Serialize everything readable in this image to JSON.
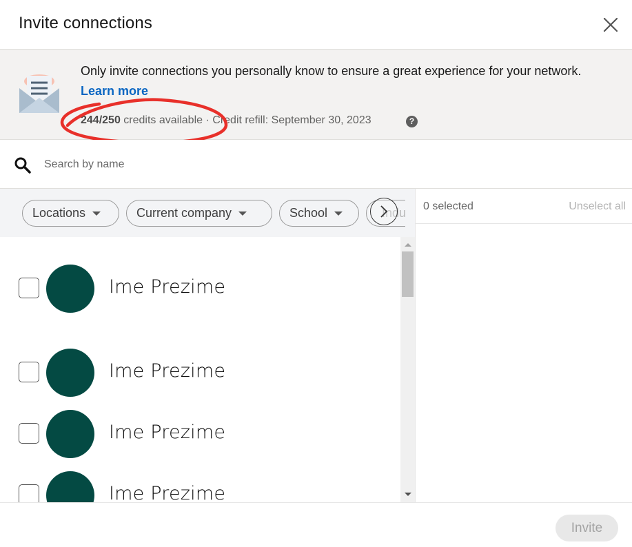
{
  "header": {
    "title": "Invite connections",
    "close_icon": "close-icon"
  },
  "notice": {
    "icon": "envelope-icon",
    "message": "Only invite connections you personally know to ensure a great experience for your network.",
    "learn_more": "Learn more",
    "credits_used": "244/250",
    "credits_label": "credits available",
    "separator": "·",
    "refill_label": "Credit refill: September 30, 2023",
    "help_icon": "help-icon",
    "help_glyph": "?"
  },
  "annotation": {
    "color": "#e8302a",
    "shape": "hand-drawn-ellipse"
  },
  "search": {
    "icon": "search-icon",
    "placeholder": "Search by name",
    "value": ""
  },
  "filters": [
    {
      "label": "Locations"
    },
    {
      "label": "Current company"
    },
    {
      "label": "School"
    },
    {
      "label": "Indu"
    }
  ],
  "filters_next_icon": "chevron-right-icon",
  "selection": {
    "count_label": "0 selected",
    "unselect_all": "Unselect all"
  },
  "connections": [
    {
      "name": "Ime Prezime",
      "checked": false,
      "avatar_color": "#044a43"
    },
    {
      "name": "Ime Prezime",
      "checked": false,
      "avatar_color": "#044a43"
    },
    {
      "name": "Ime Prezime",
      "checked": false,
      "avatar_color": "#044a43"
    },
    {
      "name": "Ime Prezime",
      "checked": false,
      "avatar_color": "#044a43"
    }
  ],
  "footer": {
    "invite_label": "Invite",
    "invite_enabled": false
  },
  "colors": {
    "link": "#0a66c2",
    "avatar": "#044a43",
    "annotation": "#e8302a"
  }
}
